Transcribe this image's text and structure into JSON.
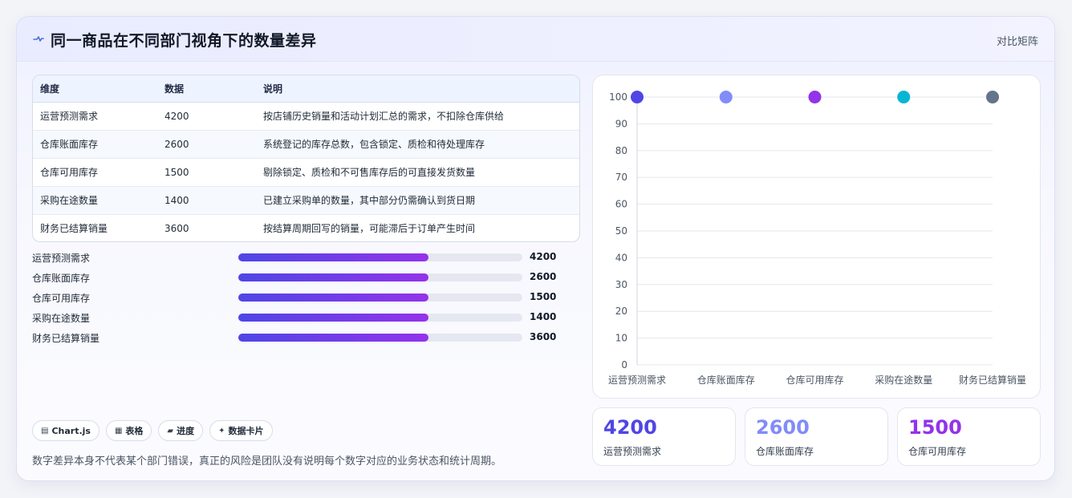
{
  "header": {
    "title": "同一商品在不同部门视角下的数量差异",
    "right_label": "对比矩阵",
    "icon": "pulse-icon"
  },
  "table": {
    "columns": [
      "维度",
      "数据",
      "说明"
    ],
    "rows": [
      {
        "dim": "运营预测需求",
        "value": "4200",
        "desc": "按店铺历史销量和活动计划汇总的需求，不扣除仓库供给"
      },
      {
        "dim": "仓库账面库存",
        "value": "2600",
        "desc": "系统登记的库存总数，包含锁定、质检和待处理库存"
      },
      {
        "dim": "仓库可用库存",
        "value": "1500",
        "desc": "剔除锁定、质检和不可售库存后的可直接发货数量"
      },
      {
        "dim": "采购在途数量",
        "value": "1400",
        "desc": "已建立采购单的数量，其中部分仍需确认到货日期"
      },
      {
        "dim": "财务已结算销量",
        "value": "3600",
        "desc": "按结算周期回写的销量，可能滞后于订单产生时间"
      }
    ]
  },
  "progress": [
    {
      "label": "运营预测需求",
      "value": "4200",
      "fill": 0.67
    },
    {
      "label": "仓库账面库存",
      "value": "2600",
      "fill": 0.67
    },
    {
      "label": "仓库可用库存",
      "value": "1500",
      "fill": 0.67
    },
    {
      "label": "采购在途数量",
      "value": "1400",
      "fill": 0.67
    },
    {
      "label": "财务已结算销量",
      "value": "3600",
      "fill": 0.67
    }
  ],
  "chips": [
    {
      "icon": "chart-icon",
      "glyph": "▤",
      "label": "Chart.js"
    },
    {
      "icon": "table-icon",
      "glyph": "▦",
      "label": "表格"
    },
    {
      "icon": "progress-icon",
      "glyph": "▰",
      "label": "进度"
    },
    {
      "icon": "sparkle-icon",
      "glyph": "✦",
      "label": "数据卡片"
    }
  ],
  "footnote": "数字差异本身不代表某个部门错误，真正的风险是团队没有说明每个数字对应的业务状态和统计周期。",
  "chart_data": {
    "type": "scatter",
    "categories": [
      "运营预测需求",
      "仓库账面库存",
      "仓库可用库存",
      "采购在途数量",
      "财务已结算销量"
    ],
    "values": [
      100,
      100,
      100,
      100,
      100
    ],
    "point_colors": [
      "#4f46e5",
      "#818cf8",
      "#9333ea",
      "#06b6d4",
      "#64748b"
    ],
    "ylim": [
      0,
      100
    ],
    "yticks": [
      0,
      10,
      20,
      30,
      40,
      50,
      60,
      70,
      80,
      90,
      100
    ],
    "grid": true
  },
  "stats": [
    {
      "value": "4200",
      "label": "运营预测需求",
      "color": "#4f46e5"
    },
    {
      "value": "2600",
      "label": "仓库账面库存",
      "color": "#818cf8"
    },
    {
      "value": "1500",
      "label": "仓库可用库存",
      "color": "#9333ea"
    }
  ]
}
